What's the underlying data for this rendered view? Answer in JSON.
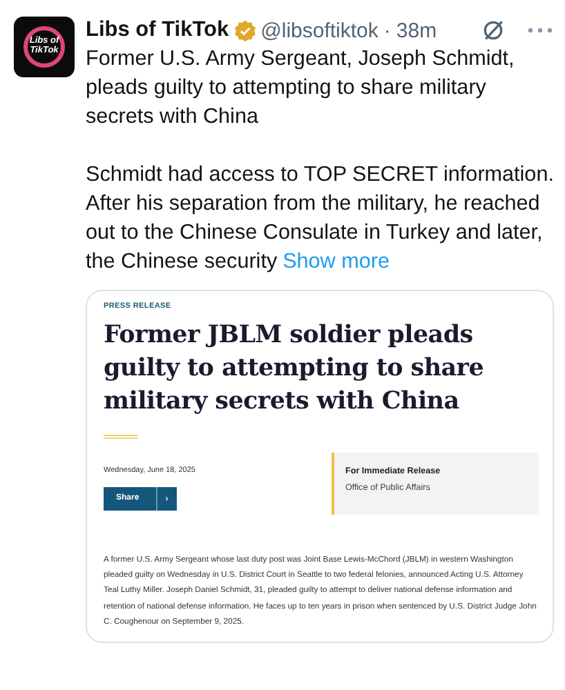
{
  "post": {
    "avatar_text": [
      "Libs of",
      "TikTok"
    ],
    "author": "Libs of TikTok",
    "verified": true,
    "handle": "@libsoftiktok",
    "separator": "·",
    "time": "38m",
    "paragraphs": [
      "Former U.S. Army Sergeant, Joseph Schmidt, pleads guilty to attempting to share military secrets with China",
      "Schmidt had access to TOP SECRET information. After his separation from the military, he reached out to the Chinese Consulate in Turkey and later, the Chinese security"
    ],
    "show_more": "Show more"
  },
  "card": {
    "label": "PRESS RELEASE",
    "headline": "Former JBLM soldier pleads guilty to attempting to share military secrets with China",
    "date": "Wednesday, June 18, 2025",
    "share_button": "Share",
    "share_caret": "›",
    "release_title": "For Immediate Release",
    "release_office": "Office of Public Affairs",
    "body": "A former U.S. Army Sergeant whose last duty post was Joint Base Lewis-McChord (JBLM) in western Washington pleaded guilty on Wednesday in U.S. District Court in Seattle to two federal felonies, announced Acting U.S. Attorney Teal Luthy Miller. Joseph Daniel Schmidt, 31, pleaded guilty to attempt to deliver national defense information and retention of national defense information. He faces up to ten years in prison when sentenced by U.S. District Judge John C. Coughenour on September 9, 2025."
  }
}
